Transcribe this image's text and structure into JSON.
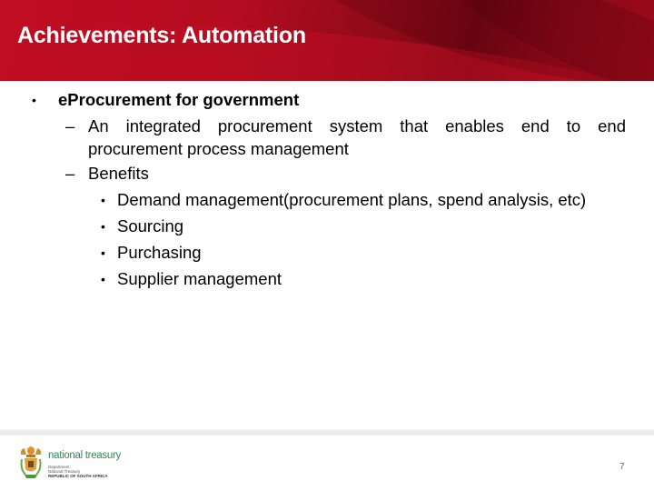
{
  "slide": {
    "title": "Achievements: Automation",
    "page_number": "7",
    "theme_color": "#b40c20"
  },
  "content": {
    "level1": {
      "bullet": "•",
      "text": "eProcurement for government"
    },
    "level2": [
      {
        "dash": "–",
        "line1_words": [
          "An",
          "integrated",
          "procurement",
          "system",
          "that",
          "enables",
          "end",
          "to",
          "end"
        ],
        "line2": "procurement process management"
      },
      {
        "dash": "–",
        "text": "Benefits"
      }
    ],
    "level3": [
      {
        "bullet": "•",
        "text": "Demand management(procurement plans, spend analysis, etc)"
      },
      {
        "bullet": "•",
        "text": "Sourcing"
      },
      {
        "bullet": "•",
        "text": "Purchasing"
      },
      {
        "bullet": "•",
        "text": "Supplier management"
      }
    ]
  },
  "footer": {
    "logo_name": "national treasury",
    "logo_line1": "Department:",
    "logo_line2": "National Treasury",
    "logo_line3": "REPUBLIC OF SOUTH AFRICA",
    "emblem_icon": "coat-of-arms-icon"
  }
}
